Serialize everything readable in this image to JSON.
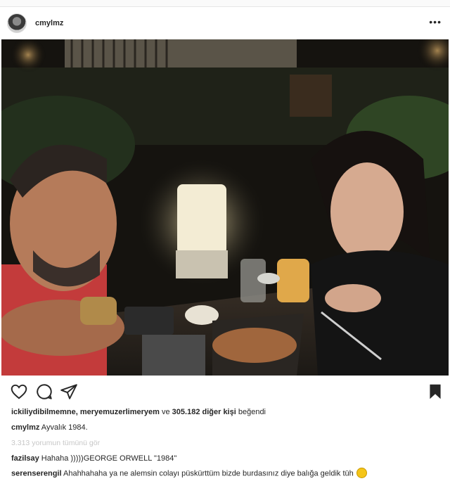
{
  "post": {
    "username": "cmylmz",
    "more_label": "•••",
    "likes": {
      "users": "ickiliydibilmemne, meryemuzerlimeryem",
      "connector": " ve ",
      "others": "305.182 diğer kişi",
      "suffix": " beğendi"
    },
    "caption": {
      "username": "cmylmz",
      "text": " Ayvalık 1984."
    },
    "view_all_comments": "3.313 yorumun tümünü gör",
    "comments": [
      {
        "username": "fazilsay",
        "text": " Hahaha )))))GEORGE ORWELL \"1984\""
      },
      {
        "username": "serenserengil",
        "text": " Ahahhahaha ya ne alemsin colayı püskürttüm bizde burdasınız diye balığa geldik tüh"
      }
    ],
    "icons": {
      "like": "heart-icon",
      "comment": "comment-icon",
      "share": "share-icon",
      "save": "bookmark-icon",
      "emoji": "grinning-face-emoji"
    }
  }
}
